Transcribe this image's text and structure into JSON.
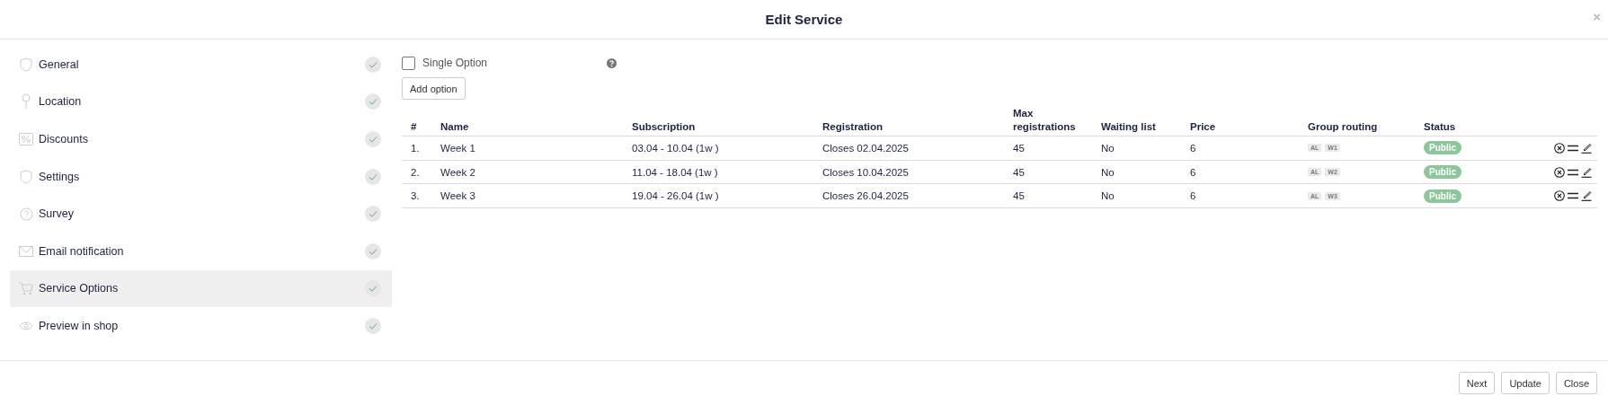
{
  "window": {
    "title": "Edit Service",
    "close": "×"
  },
  "sidebar": {
    "items": [
      {
        "label": "General",
        "selected": false,
        "completed": true
      },
      {
        "label": "Location",
        "selected": false,
        "completed": true
      },
      {
        "label": "Discounts",
        "selected": false,
        "completed": true
      },
      {
        "label": "Settings",
        "selected": false,
        "completed": true
      },
      {
        "label": "Survey",
        "selected": false,
        "completed": true
      },
      {
        "label": "Email notification",
        "selected": false,
        "completed": true
      },
      {
        "label": "Service Options",
        "selected": true,
        "completed": true
      },
      {
        "label": "Preview in shop",
        "selected": false,
        "completed": true
      }
    ]
  },
  "single_option": {
    "label": "Single Option",
    "checked": false
  },
  "add_option_button": "Add option",
  "table": {
    "columns": [
      "#",
      "Name",
      "Subscription",
      "Registration",
      "Max registrations",
      "Waiting list",
      "Price",
      "Group routing",
      "Status"
    ],
    "rows": [
      {
        "index": "1.",
        "name": "Week 1",
        "subscription": "03.04 - 10.04 (1w )",
        "registration": "Closes 02.04.2025",
        "max": "45",
        "waiting": "No",
        "price": "6",
        "routing": [
          "AL",
          "W1"
        ],
        "status": "Public"
      },
      {
        "index": "2.",
        "name": "Week 2",
        "subscription": "11.04 - 18.04 (1w )",
        "registration": "Closes 10.04.2025",
        "max": "45",
        "waiting": "No",
        "price": "6",
        "routing": [
          "AL",
          "W2"
        ],
        "status": "Public"
      },
      {
        "index": "3.",
        "name": "Week 3",
        "subscription": "19.04 - 26.04 (1w )",
        "registration": "Closes 26.04.2025",
        "max": "45",
        "waiting": "No",
        "price": "6",
        "routing": [
          "AL",
          "W3"
        ],
        "status": "Public"
      }
    ]
  },
  "footer": {
    "buttons": [
      "Next",
      "Update",
      "Close"
    ]
  }
}
